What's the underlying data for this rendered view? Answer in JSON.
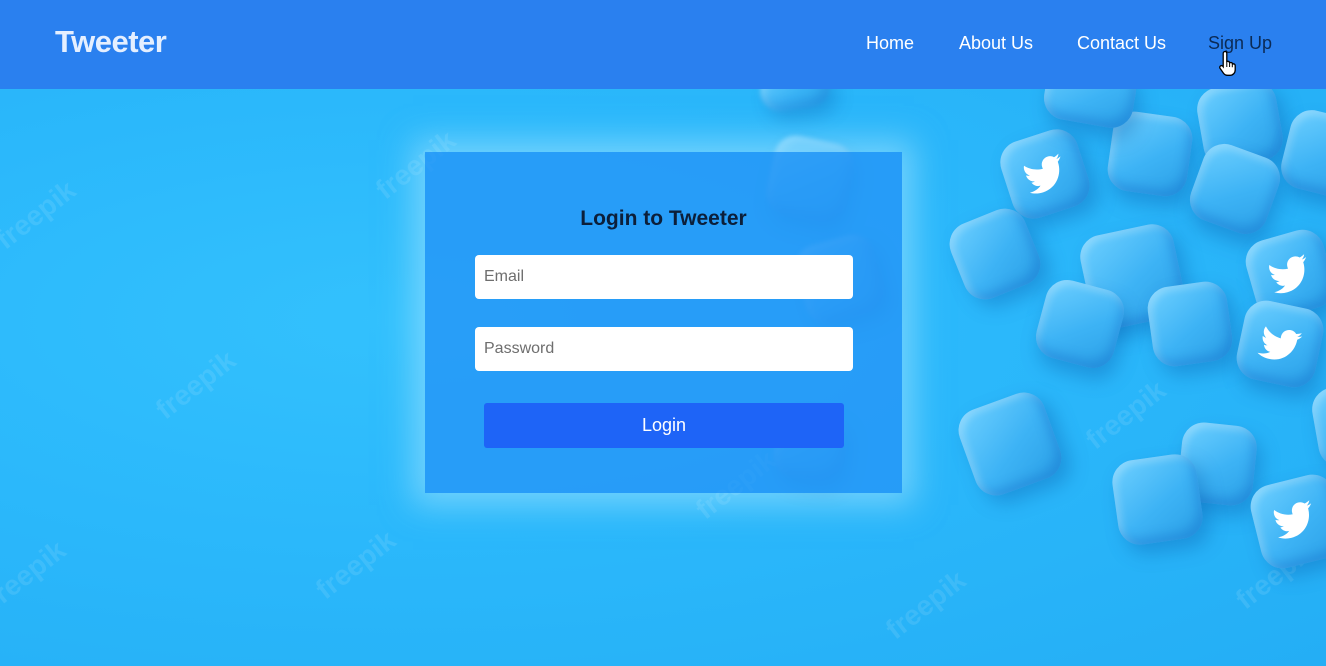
{
  "navbar": {
    "brand": "Tweeter",
    "links": [
      {
        "label": "Home"
      },
      {
        "label": "About Us"
      },
      {
        "label": "Contact Us"
      },
      {
        "label": "Sign Up"
      }
    ]
  },
  "login": {
    "title": "Login to Tweeter",
    "email_placeholder": "Email",
    "password_placeholder": "Password",
    "button_label": "Login"
  },
  "colors": {
    "navbar_bg": "#2a80ef",
    "hero_bg": "#2ab8f9",
    "card_bg": "#2696f6",
    "button_bg": "#1e64f7"
  },
  "icons": [
    "bird-icon",
    "hand-pointer-cursor-icon"
  ]
}
